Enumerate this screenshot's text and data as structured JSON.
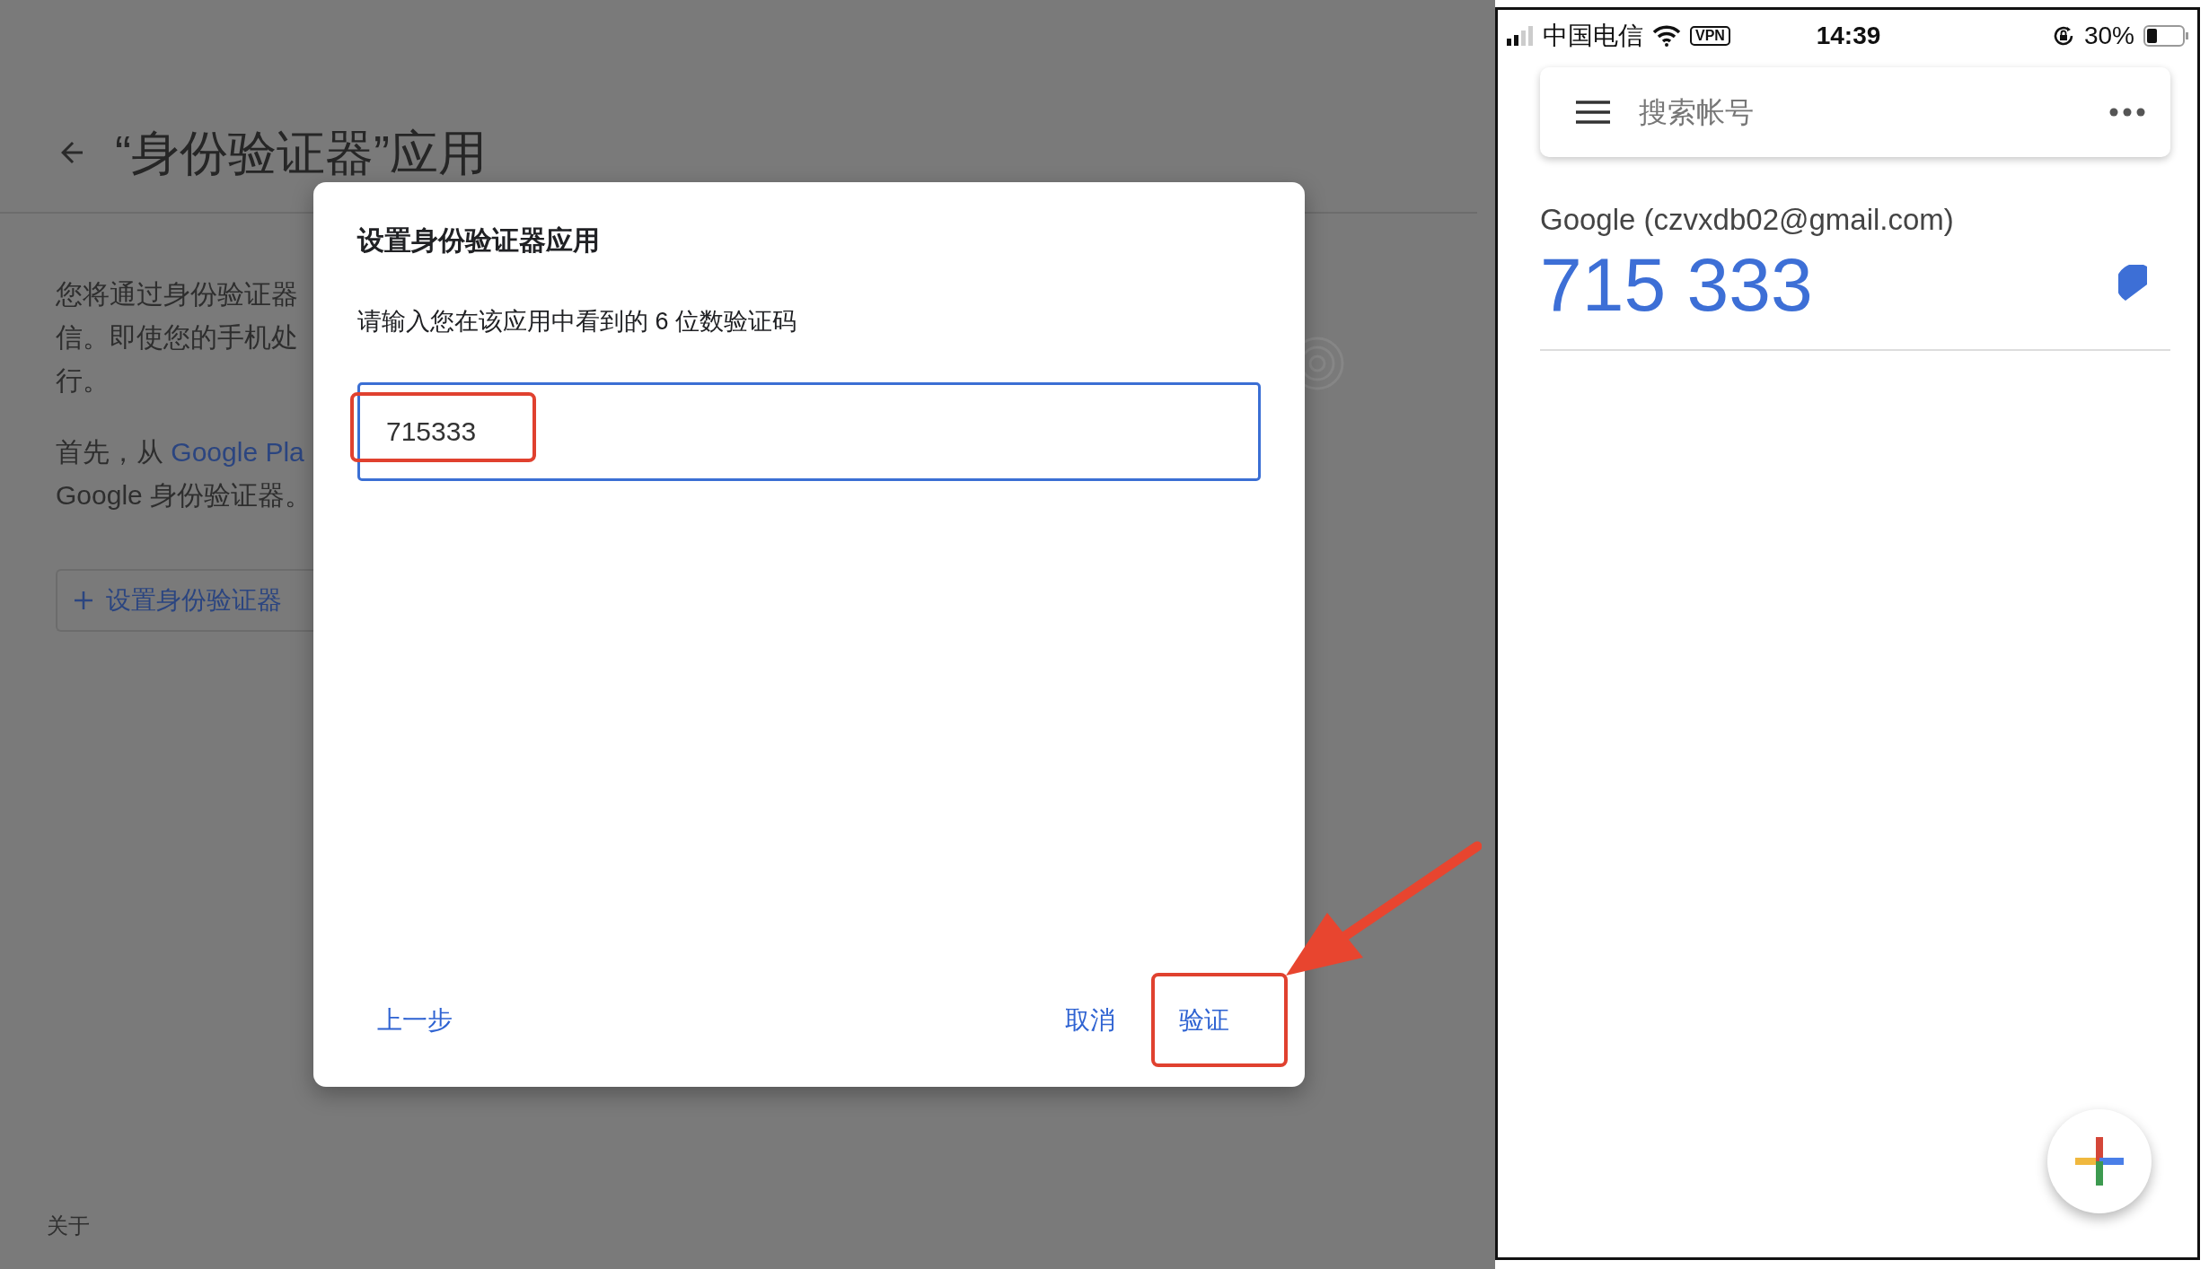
{
  "background_page": {
    "title": "“身份验证器”应用",
    "intro_lines": [
      "您将通过身份验证器",
      "信。即使您的手机处",
      "行。"
    ],
    "source_line": {
      "text": "首先，从 ",
      "link": "Google Pla"
    },
    "source_line_2": "Google 身份验证器。",
    "setup_button": "设置身份验证器",
    "footer_link": "关于"
  },
  "dialog": {
    "title": "设置身份验证器应用",
    "instruction": "请输入您在该应用中看到的 6 位数验证码",
    "code_field": {
      "value": "715333",
      "highlighted": true
    },
    "buttons": [
      {
        "label": "上一步",
        "highlighted": false
      },
      {
        "label": "取消",
        "highlighted": false
      },
      {
        "label": "验证",
        "highlighted": true
      }
    ]
  },
  "phone": {
    "status_bar": {
      "carrier": "中国电信",
      "vpn": "VPN",
      "time": "14:39",
      "battery": "30%"
    },
    "search": {
      "placeholder": "搜索帐号"
    },
    "accounts": [
      {
        "name": "Google (czvxdb02@gmail.com)",
        "code": "715 333"
      }
    ]
  }
}
